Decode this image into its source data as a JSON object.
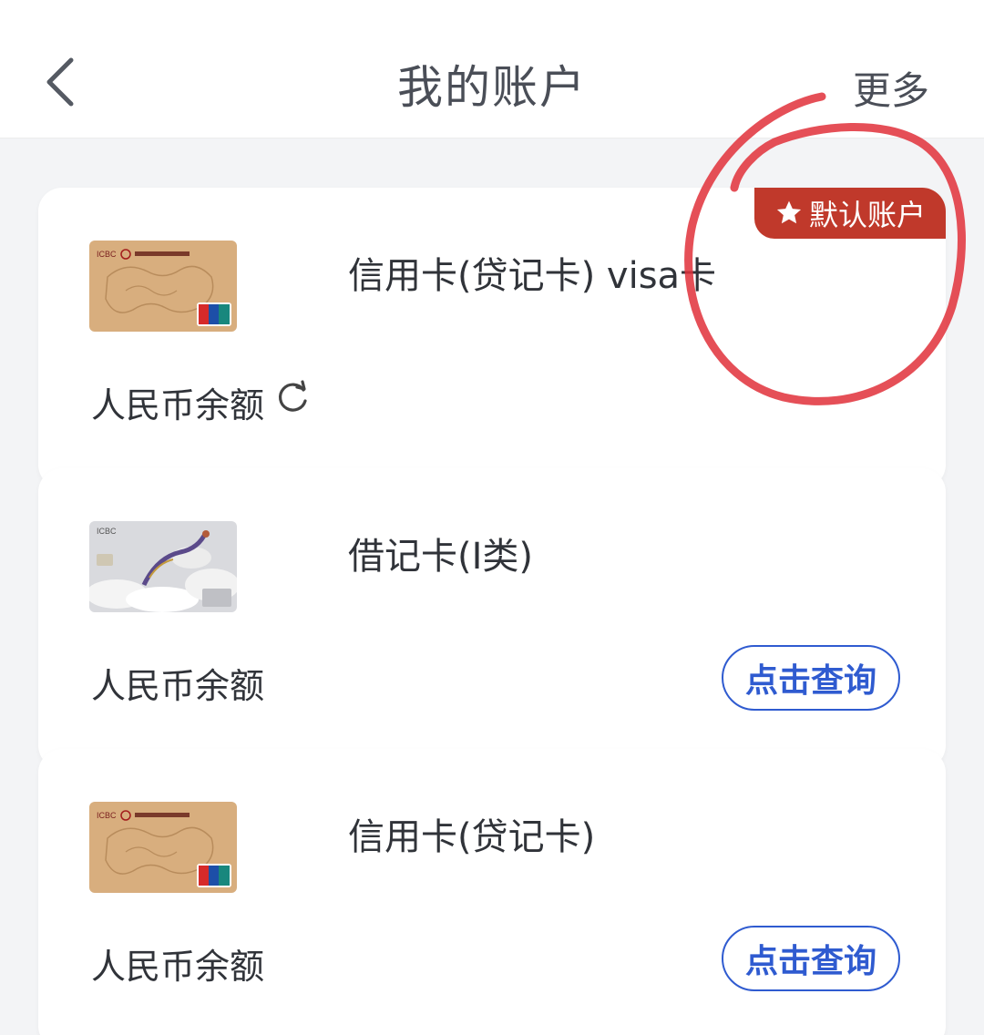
{
  "header": {
    "title": "我的账户",
    "more_label": "更多",
    "back_icon": "chevron-left-icon"
  },
  "colors": {
    "accent_blue": "#2f5bd0",
    "badge_red": "#c0392b",
    "annotation_red": "#e0303a",
    "card_gold": "#d8ae7e"
  },
  "accounts": [
    {
      "name": "信用卡(贷记卡) visa卡",
      "balance_label": "人民币余额",
      "badge": "默认账户",
      "icon": "refresh-icon",
      "thumb": "gold-credit-card"
    },
    {
      "name": "借记卡(I类)",
      "balance_label": "人民币余额",
      "query_label": "点击查询",
      "thumb": "dragon-debit-card"
    },
    {
      "name": "信用卡(贷记卡)",
      "balance_label": "人民币余额",
      "query_label": "点击查询",
      "thumb": "gold-credit-card"
    }
  ]
}
